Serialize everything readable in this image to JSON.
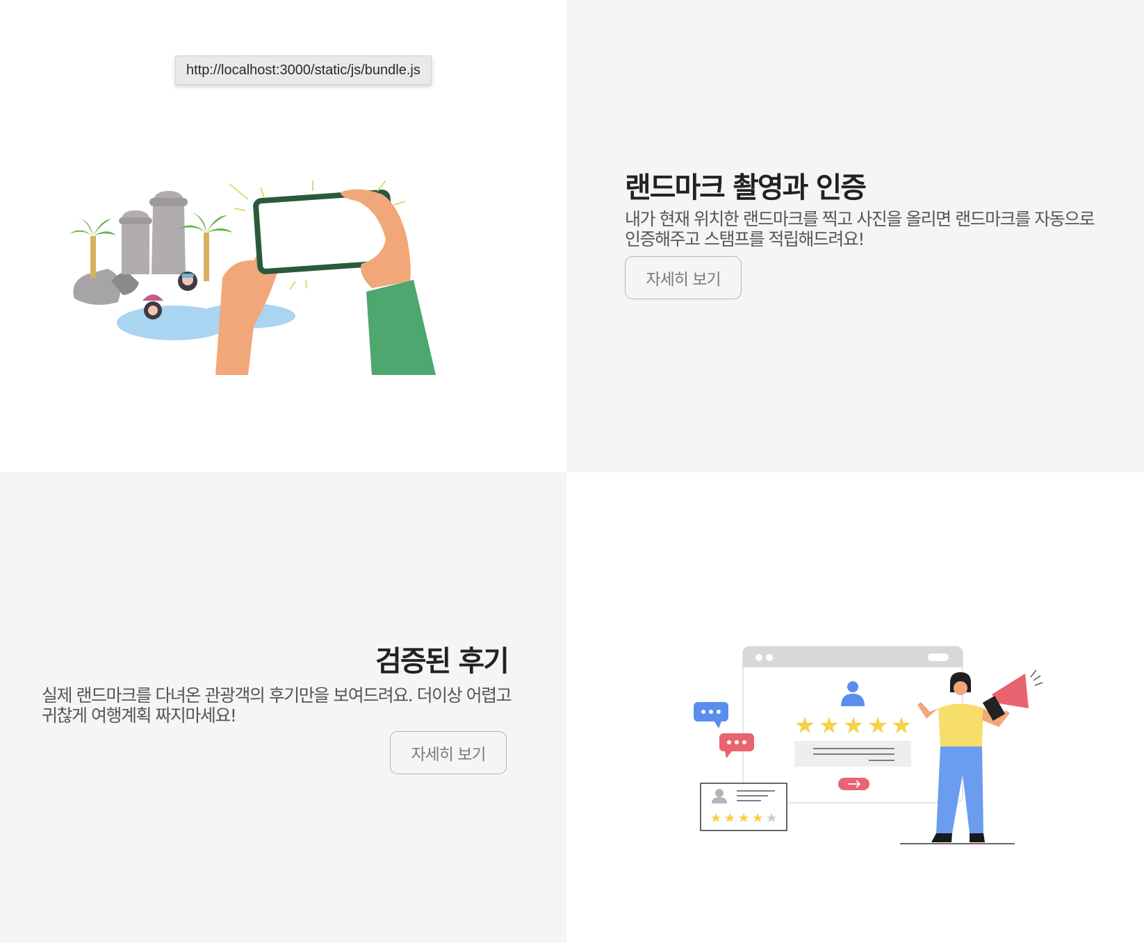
{
  "tooltip": {
    "text": "http://localhost:3000/static/js/bundle.js"
  },
  "section_landmark": {
    "title": "랜드마크 촬영과 인증",
    "description": "내가 현재 위치한 랜드마크를 찍고 사진을 올리면 랜드마크를 자동으로 인증해주고 스탬프를 적립해드려요!",
    "button_label": "자세히 보기",
    "illustration": "phone-photographing-jeju-landmark-illustration"
  },
  "section_reviews": {
    "title": "검증된 후기",
    "description": "실제 랜드마크를 다녀온 관광객의 후기만을 보여드려요. 더이상 어렵고 귀찮게 여행계획 짜지마세요!",
    "button_label": "자세히 보기",
    "illustration": "woman-with-megaphone-reviews-illustration"
  },
  "colors": {
    "panel_white": "#ffffff",
    "panel_gray": "#f5f5f5",
    "title_text": "#222222",
    "body_text": "#555555",
    "button_border": "#b4b4b4",
    "button_text": "#7b7b7b",
    "star_yellow": "#f7d147",
    "accent_red": "#e86470",
    "accent_blue": "#5b8def",
    "sleeve_green": "#4da76f",
    "phone_frame": "#2a5a3c"
  }
}
